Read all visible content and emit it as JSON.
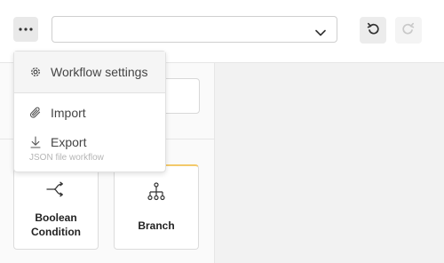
{
  "toolbar": {
    "more_icon": "more-horizontal-icon",
    "workflow_select": {
      "value": ""
    },
    "undo_icon": "undo-icon",
    "redo_icon": "redo-icon"
  },
  "menu": {
    "items": [
      {
        "icon": "gear-icon",
        "label": "Workflow settings"
      },
      {
        "icon": "paperclip-icon",
        "label": "Import"
      },
      {
        "icon": "download-icon",
        "label": "Export",
        "sublabel": "JSON file workflow"
      }
    ]
  },
  "left_panel": {
    "search": {
      "value": ""
    },
    "cards": [
      {
        "icon": "boolean-condition-icon",
        "label_line1": "Boolean",
        "label_line2": "Condition"
      },
      {
        "icon": "branch-icon",
        "label": "Branch"
      }
    ]
  },
  "colors": {
    "accent_border": "#f3c96a",
    "canvas_bg": "#f2f2f2"
  }
}
